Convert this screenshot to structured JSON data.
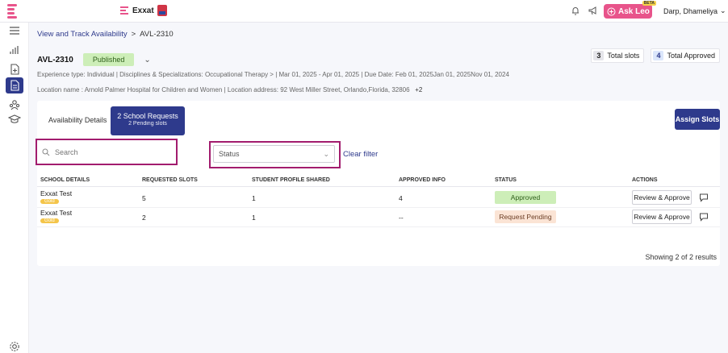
{
  "app": {
    "brand_name": "Exxat",
    "ask_leo_label": "Ask Leo",
    "ask_leo_badge": "BETA",
    "user_name": "Darp, Dhameliya",
    "accent_color": "#2e3a8c",
    "highlight_color": "#a21c6e"
  },
  "breadcrumb": {
    "link": "View and Track Availability",
    "separator": ">",
    "current": "AVL-2310"
  },
  "header": {
    "title": "AVL-2310",
    "status": "Published",
    "total_slots_count": "3",
    "total_slots_label": "Total slots",
    "total_approved_count": "4",
    "total_approved_label": "Total Approved"
  },
  "meta": {
    "line1": "Experience type: Individual  |  Disciplines & Specializations: Occupational Therapy  >  |  Mar 01, 2025  -  Apr 01, 2025  |  Due Date: Feb 01, 2025Jan 01, 2025Nov 01, 2024",
    "line2_prefix": "Location name : Arnold Palmer Hospital for Children and Women  |  Location address: 92 West Miller Street, Orlando,Florida, 32806",
    "line2_more": "+2"
  },
  "tabs": {
    "availability_details": "Availability Details",
    "school_requests": "2 School Requests",
    "school_requests_sub": "2 Pending slots"
  },
  "actions": {
    "assign_slots": "Assign Slots",
    "clear_filter": "Clear filter"
  },
  "filters": {
    "search_placeholder": "Search",
    "status_placeholder": "Status"
  },
  "table": {
    "columns": [
      "SCHOOL DETAILS",
      "REQUESTED SLOTS",
      "STUDENT PROFILE SHARED",
      "APPROVED INFO",
      "STATUS",
      "ACTIONS"
    ],
    "rows": [
      {
        "school": "Exxat Test",
        "tier": "Gold",
        "requested": "5",
        "shared": "1",
        "approved": "4",
        "status": "Approved",
        "action": "Review & Approve"
      },
      {
        "school": "Exxat Test",
        "tier": "Gold",
        "requested": "2",
        "shared": "1",
        "approved": "--",
        "status": "Request Pending",
        "action": "Review & Approve"
      }
    ],
    "footer": "Showing 2 of 2 results"
  }
}
